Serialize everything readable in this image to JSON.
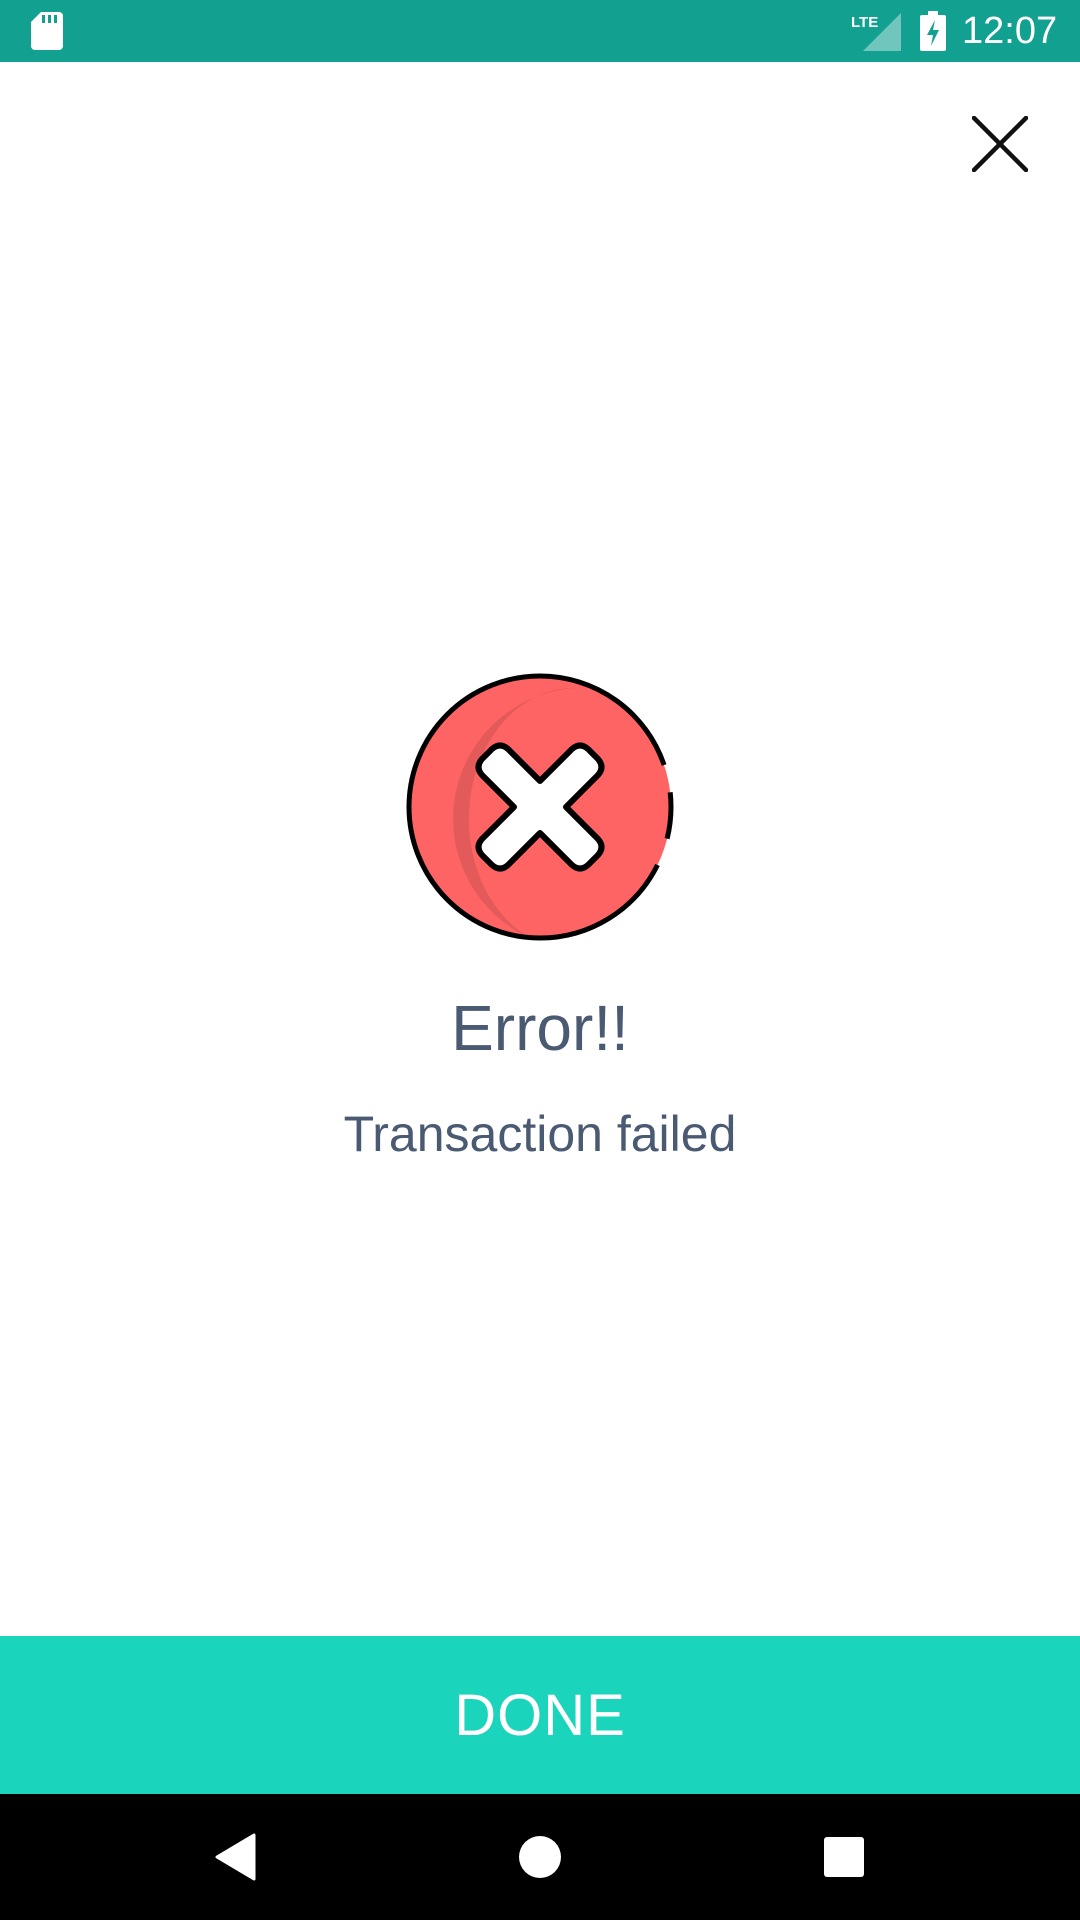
{
  "status_bar": {
    "time": "12:07",
    "network_label": "LTE",
    "icons": [
      "sd-card-icon",
      "lte-signal-icon",
      "battery-charging-icon"
    ],
    "background_color": "#12a190"
  },
  "header": {
    "close_icon": "close-icon"
  },
  "result": {
    "icon": "error-x-circle-icon",
    "title": "Error!!",
    "message": "Transaction failed",
    "icon_color": "#ff6464",
    "text_color": "#4a5a73"
  },
  "footer": {
    "done_label": "DONE",
    "button_color": "#1ad4bb"
  },
  "navigation": {
    "icons": [
      "back-icon",
      "home-icon",
      "recents-icon"
    ]
  }
}
